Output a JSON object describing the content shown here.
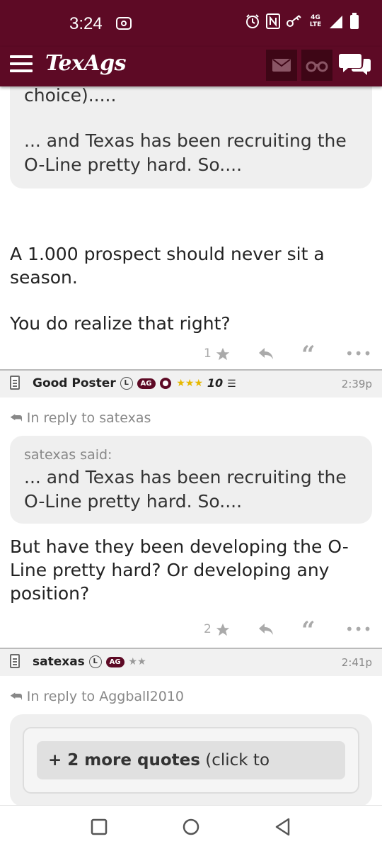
{
  "status_bar": {
    "time": "3:24",
    "network_label": "4G LTE",
    "icons": [
      "screen-record-icon",
      "alarm-icon",
      "nfc-icon",
      "key-icon",
      "signal-icon",
      "battery-icon"
    ]
  },
  "navbar": {
    "logo": "TexAgs",
    "icons": [
      "menu-icon",
      "mail-icon",
      "binoculars-icon",
      "chat-icon"
    ]
  },
  "post1": {
    "quote_tail_line1": "choice).....",
    "quote_tail_line2": "... and Texas has been recruiting the O-Line pretty hard. So....",
    "body_para1": "A 1.000 prospect should never sit a season.",
    "body_para2": "You do realize that right?",
    "star_count": "1"
  },
  "post2": {
    "username": "Good Poster",
    "badge_l": "L",
    "badge_ag": "AG",
    "stars": "★★★",
    "tenth_label": "10",
    "time": "2:39p",
    "in_reply_to": "In reply to satexas",
    "quote_author": "satexas said:",
    "quote_text": "... and Texas has been recruiting the O-Line pretty hard. So....",
    "body": "But have they been developing the O-Line pretty hard? Or developing any position?",
    "star_count": "2"
  },
  "post3": {
    "username": "satexas",
    "badge_l": "L",
    "badge_ag": "AG",
    "stars": "★★",
    "time": "2:41p",
    "in_reply_to": "In reply to Aggball2010",
    "more_quotes_bold": "+ 2 more quotes",
    "more_quotes_rest": " (click to"
  },
  "colors": {
    "brand": "#5d0a25",
    "quote_bg": "#efefef",
    "muted": "#888888",
    "star_gold": "#e6b800"
  }
}
